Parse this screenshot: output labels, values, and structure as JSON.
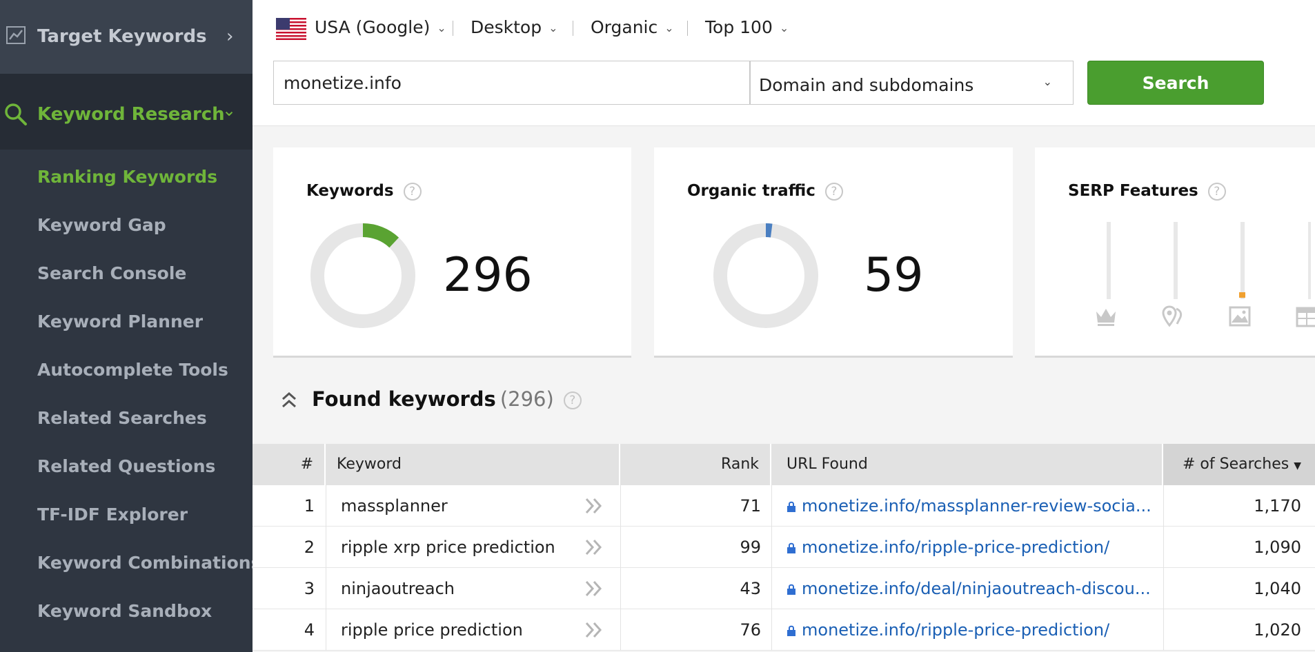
{
  "sidebar": {
    "top_item": "Target Keywords",
    "section": "Keyword Research",
    "items": [
      {
        "label": "Ranking Keywords",
        "active": true
      },
      {
        "label": "Keyword Gap"
      },
      {
        "label": "Search Console"
      },
      {
        "label": "Keyword Planner"
      },
      {
        "label": "Autocomplete Tools"
      },
      {
        "label": "Related Searches"
      },
      {
        "label": "Related Questions"
      },
      {
        "label": "TF-IDF Explorer"
      },
      {
        "label": "Keyword Combinations"
      },
      {
        "label": "Keyword Sandbox"
      }
    ]
  },
  "filters": {
    "country": "USA (Google)",
    "device": "Desktop",
    "type": "Organic",
    "depth": "Top 100"
  },
  "search": {
    "query": "monetize.info",
    "scope": "Domain and subdomains",
    "button": "Search"
  },
  "cards": {
    "keywords": {
      "title": "Keywords",
      "value": "296",
      "fraction": 0.12
    },
    "traffic": {
      "title": "Organic traffic",
      "value": "59",
      "fraction": 0.02
    },
    "serp": {
      "title": "SERP Features",
      "icons": [
        "crown-icon",
        "map-pin-icon",
        "image-icon",
        "calendar-icon"
      ],
      "levels": [
        0,
        0,
        0.05,
        0
      ]
    }
  },
  "found": {
    "title": "Found keywords",
    "count": "(296)"
  },
  "table": {
    "headers": {
      "num": "#",
      "keyword": "Keyword",
      "rank": "Rank",
      "url": "URL Found",
      "searches": "# of Searches"
    },
    "rows": [
      {
        "num": "1",
        "keyword": "massplanner",
        "rank": "71",
        "url": "monetize.info/massplanner-review-socia...",
        "searches": "1,170"
      },
      {
        "num": "2",
        "keyword": "ripple xrp price prediction",
        "rank": "99",
        "url": "monetize.info/ripple-price-prediction/",
        "searches": "1,090"
      },
      {
        "num": "3",
        "keyword": "ninjaoutreach",
        "rank": "43",
        "url": "monetize.info/deal/ninjaoutreach-discou...",
        "searches": "1,040"
      },
      {
        "num": "4",
        "keyword": "ripple price prediction",
        "rank": "76",
        "url": "monetize.info/ripple-price-prediction/",
        "searches": "1,020"
      }
    ]
  },
  "colors": {
    "accent": "#6fb53a",
    "button": "#4a9e2f",
    "link": "#1a5fb4",
    "traffic": "#4a7fc1",
    "serp_bar": "#f0a030"
  }
}
